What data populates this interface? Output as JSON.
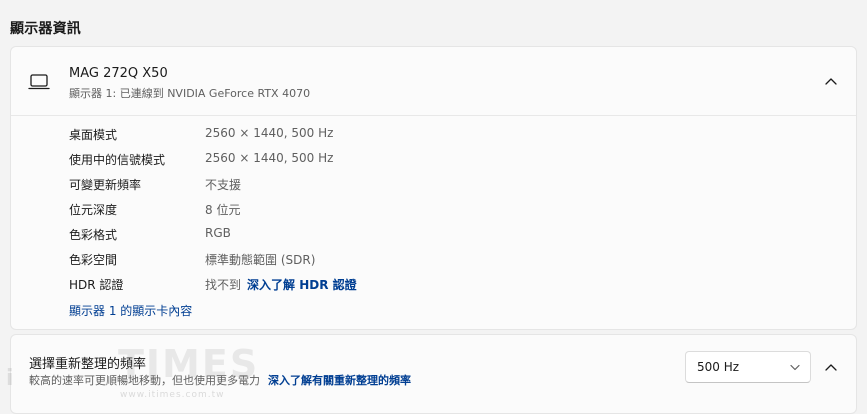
{
  "section": {
    "title": "顯示器資訊"
  },
  "monitor": {
    "name": "MAG 272Q X50",
    "subtitle": "顯示器 1: 已連線到 NVIDIA GeForce RTX 4070",
    "icon": "laptop-icon"
  },
  "details": [
    {
      "label": "桌面模式",
      "value": "2560 × 1440, 500 Hz"
    },
    {
      "label": "使用中的信號模式",
      "value": "2560 × 1440, 500 Hz"
    },
    {
      "label": "可變更新頻率",
      "value": "不支援"
    },
    {
      "label": "位元深度",
      "value": "8 位元"
    },
    {
      "label": "色彩格式",
      "value": "RGB"
    },
    {
      "label": "色彩空間",
      "value": "標準動態範圍 (SDR)"
    },
    {
      "label": "HDR 認證",
      "value": "找不到",
      "link": "深入了解 HDR 認證"
    }
  ],
  "adapter_link": "顯示器 1 的顯示卡內容",
  "refresh": {
    "title": "選擇重新整理的頻率",
    "subtitle": "較高的速率可更順暢地移動，但也使用更多電力",
    "link": "深入了解有關重新整理的頻率",
    "selected": "500 Hz"
  },
  "watermark": {
    "brand": "TIMES",
    "prefix": "i",
    "url": "www.itimes.com.tw"
  },
  "colors": {
    "background": "#f3f3f3",
    "card": "#fbfbfb",
    "link": "#003e92",
    "secondary_text": "#5f5f5f"
  }
}
